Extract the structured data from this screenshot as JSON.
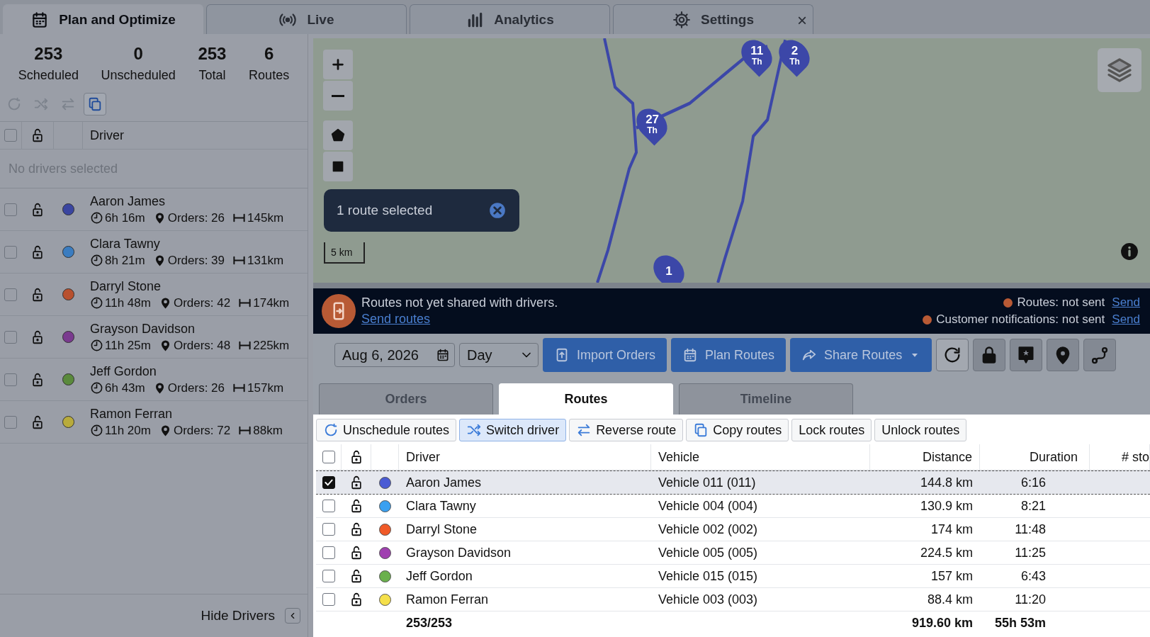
{
  "tabs": [
    {
      "label": "Plan and Optimize",
      "selected": true
    },
    {
      "label": "Live",
      "selected": false
    },
    {
      "label": "Analytics",
      "selected": false
    },
    {
      "label": "Settings",
      "selected": false,
      "close": "×"
    }
  ],
  "summary": [
    {
      "value": "253",
      "label": "Scheduled"
    },
    {
      "value": "0",
      "label": "Unscheduled"
    },
    {
      "value": "253",
      "label": "Total"
    },
    {
      "value": "6",
      "label": "Routes"
    }
  ],
  "sidebar": {
    "tools": [
      {
        "selected": false
      },
      {
        "selected": false
      },
      {
        "selected": false
      },
      {
        "selected": true
      }
    ],
    "all_checked": false,
    "header": "Driver",
    "empty": "No drivers selected",
    "drivers": [
      {
        "name": "Aaron James",
        "color": "#3a45a0",
        "checked": false,
        "time": "6h 16m",
        "orders": "Orders: 26",
        "distance": "145km"
      },
      {
        "name": "Clara Tawny",
        "color": "#3a7cc0",
        "checked": false,
        "time": "8h 21m",
        "orders": "Orders: 39",
        "distance": "131km"
      },
      {
        "name": "Darryl Stone",
        "color": "#b8502e",
        "checked": false,
        "time": "11h 48m",
        "orders": "Orders: 42",
        "distance": "174km"
      },
      {
        "name": "Grayson Davidson",
        "color": "#7a3a8f",
        "checked": false,
        "time": "11h 25m",
        "orders": "Orders: 48",
        "distance": "225km"
      },
      {
        "name": "Jeff Gordon",
        "color": "#5a8a3c",
        "checked": false,
        "time": "6h 43m",
        "orders": "Orders: 26",
        "distance": "157km"
      },
      {
        "name": "Ramon Ferran",
        "color": "#b8ab3c",
        "checked": false,
        "time": "11h 20m",
        "orders": "Orders: 72",
        "distance": "88km"
      }
    ],
    "hide": "Hide Drivers"
  },
  "map": {
    "pins": [
      {
        "number": "11",
        "day": "Th"
      },
      {
        "number": "2",
        "day": "Th"
      },
      {
        "number": "27",
        "day": "Th"
      },
      {
        "number": "1"
      }
    ],
    "selection": "1 route selected",
    "scale": "5 km"
  },
  "banner": {
    "message": "Routes not yet shared with drivers.",
    "link": "Send routes",
    "statuses": [
      {
        "label": "Routes: not sent",
        "link": "Send"
      },
      {
        "label": "Customer notifications: not sent",
        "link": "Send"
      }
    ]
  },
  "toolbar": {
    "date": "Aug 6, 2026",
    "period": "Day",
    "buttons": [
      {
        "label": "Import Orders",
        "dropdown": false
      },
      {
        "label": "Plan Routes",
        "dropdown": false
      },
      {
        "label": "Share Routes",
        "dropdown": true
      }
    ]
  },
  "view_tabs": [
    {
      "label": "Orders",
      "selected": false
    },
    {
      "label": "Routes",
      "selected": true
    },
    {
      "label": "Timeline",
      "selected": false
    }
  ],
  "actions": [
    {
      "label": "Unschedule routes",
      "selected": false
    },
    {
      "label": "Switch driver",
      "selected": true
    },
    {
      "label": "Reverse route",
      "selected": false
    },
    {
      "label": "Copy routes",
      "selected": false
    },
    {
      "label": "Lock routes",
      "selected": false
    },
    {
      "label": "Unlock routes",
      "selected": false
    }
  ],
  "table": {
    "all_checked": false,
    "columns": [
      "Driver",
      "Vehicle",
      "Distance",
      "Duration",
      "# sto"
    ],
    "rows": [
      {
        "checked": true,
        "color": "#4a5bd4",
        "driver": "Aaron James",
        "vehicle": "Vehicle 011 (011)",
        "distance": "144.8 km",
        "duration": "6:16"
      },
      {
        "checked": false,
        "color": "#3aa0f0",
        "driver": "Clara Tawny",
        "vehicle": "Vehicle 004 (004)",
        "distance": "130.9 km",
        "duration": "8:21"
      },
      {
        "checked": false,
        "color": "#f05a28",
        "driver": "Darryl Stone",
        "vehicle": "Vehicle 002 (002)",
        "distance": "174 km",
        "duration": "11:48"
      },
      {
        "checked": false,
        "color": "#a040b0",
        "driver": "Grayson Davidson",
        "vehicle": "Vehicle 005 (005)",
        "distance": "224.5 km",
        "duration": "11:25"
      },
      {
        "checked": false,
        "color": "#6ab04c",
        "driver": "Jeff Gordon",
        "vehicle": "Vehicle 015 (015)",
        "distance": "157 km",
        "duration": "6:43"
      },
      {
        "checked": false,
        "color": "#f5e04a",
        "driver": "Ramon Ferran",
        "vehicle": "Vehicle 003 (003)",
        "distance": "88.4 km",
        "duration": "11:20"
      }
    ],
    "totals": {
      "driver": "253/253",
      "distance": "919.60 km",
      "duration": "55h 53m"
    }
  }
}
